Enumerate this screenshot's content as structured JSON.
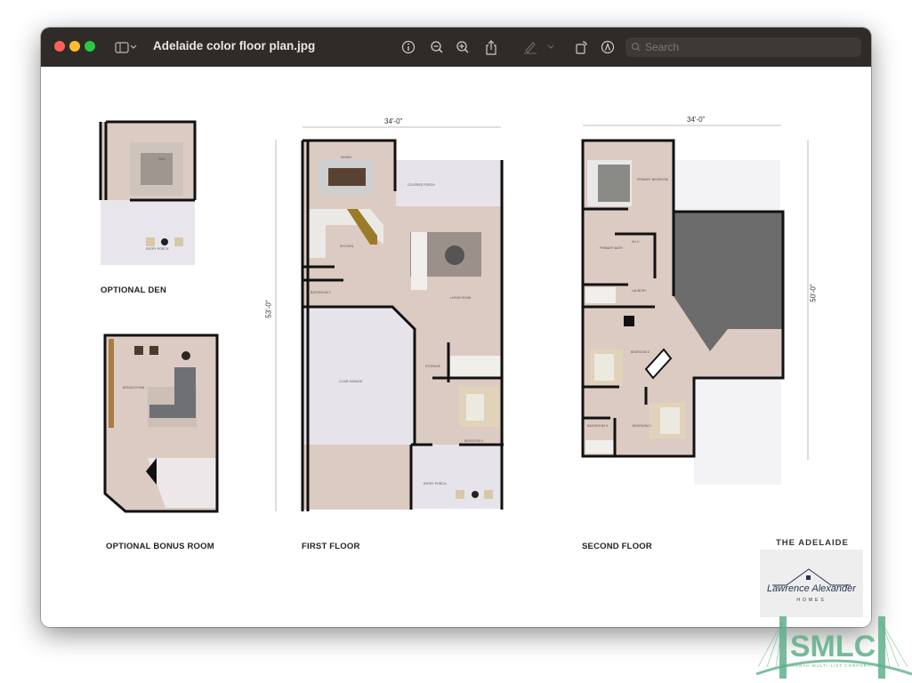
{
  "window": {
    "title": "Adelaide color floor plan.jpg",
    "search_placeholder": "Search",
    "toolbar_icons": [
      "sidebar-icon",
      "chevron-down-icon",
      "info-icon",
      "zoom-out-icon",
      "zoom-in-icon",
      "share-icon",
      "highlight-pen-icon",
      "chevron-down-icon",
      "rotate-icon",
      "markup-icon",
      "search-icon"
    ],
    "traffic_lights": {
      "close": "#fe5f57",
      "minimize": "#febc2e",
      "zoom": "#28c840"
    }
  },
  "plan": {
    "labels": {
      "optional_den": "OPTIONAL DEN",
      "optional_bonus_room": "OPTIONAL BONUS ROOM",
      "first_floor": "FIRST FLOOR",
      "second_floor": "SECOND FLOOR",
      "model_name": "THE ADELAIDE"
    },
    "dimensions": {
      "first_width": "34'-0\"",
      "first_depth": "53'-0\"",
      "second_width": "34'-0\"",
      "second_depth": "50'-0\""
    },
    "rooms": {
      "dining": "DINING",
      "covered_porch": "COVERED PORCH",
      "kitchen": "KITCHEN",
      "living_room": "LIVING ROOM",
      "bathroom_2": "BATHROOM 2",
      "garage": "2-CAR GARAGE",
      "storage": "STORAGE",
      "bedroom_4": "BEDROOM 4",
      "entry_porch": "ENTRY PORCH",
      "primary_bedroom": "PRIMARY BEDROOM",
      "primary_bath": "PRIMARY BATH",
      "wic": "W.I.C.",
      "laundry": "LAUNDRY",
      "bedroom_2": "BEDROOM 2",
      "bedroom_3": "BEDROOM 3",
      "bathroom_3": "BATHROOM 3",
      "den": "DEN",
      "den_entry_porch": "ENTRY PORCH",
      "bonus_room": "BONUS ROOM"
    },
    "builder_logo": {
      "name": "Lawrence Alexander",
      "sub": "HOMES"
    },
    "watermark": {
      "text": "SMLC",
      "sub": "SAVANNAH MULTI-LIST CORPORATION",
      "color": "#5fb08a"
    },
    "colors": {
      "floor": "#dccbc2",
      "wall": "#111111",
      "garage": "#e6e4ea",
      "open_to_below": "#6c6c6c"
    }
  }
}
